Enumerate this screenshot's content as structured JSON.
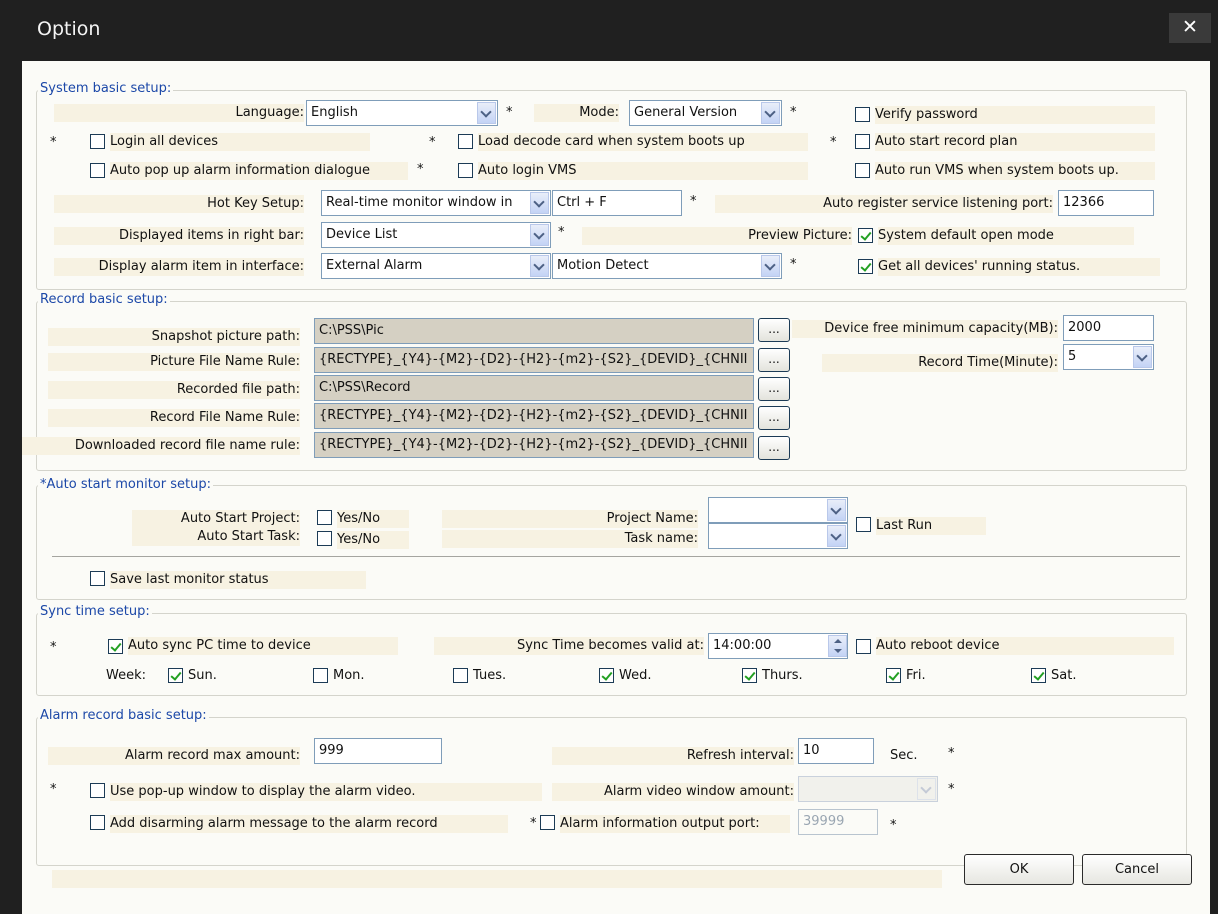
{
  "window": {
    "title": "Option",
    "close_glyph": "✕"
  },
  "star": "*",
  "system": {
    "title": "System basic setup:",
    "language_label": "Language:",
    "language_value": "English",
    "mode_label": "Mode:",
    "mode_value": "General Version",
    "verify_password": "Verify password",
    "login_all_devices": "Login all devices",
    "load_decode_card": "Load decode card when system boots up",
    "auto_start_record_plan": "Auto start record plan",
    "auto_popup_alarm": "Auto pop up alarm information dialogue",
    "auto_login_vms": "Auto login VMS",
    "auto_run_vms": "Auto run VMS when system boots up.",
    "hotkey_label": "Hot Key Setup:",
    "hotkey_select": "Real-time monitor window in",
    "hotkey_value": "Ctrl + F",
    "auto_register_label": "Auto register service listening port:",
    "auto_register_value": "12366",
    "right_bar_label": "Displayed items in right bar:",
    "right_bar_value": "Device List",
    "preview_label": "Preview Picture:",
    "preview_value": "System default open mode",
    "display_alarm_label": "Display alarm item in interface:",
    "display_alarm_value1": "External Alarm",
    "display_alarm_value2": "Motion Detect",
    "get_all_status": "Get all devices' running status."
  },
  "record": {
    "title": "Record basic setup:",
    "snapshot_label": "Snapshot picture path:",
    "snapshot_value": "C:\\PSS\\Pic",
    "picture_rule_label": "Picture File Name Rule:",
    "picture_rule_value": "{RECTYPE}_{Y4}-{M2}-{D2}-{H2}-{m2}-{S2}_{DEVID}_{CHNII",
    "recorded_path_label": "Recorded file  path:",
    "recorded_path_value": "C:\\PSS\\Record",
    "record_rule_label": "Record File Name Rule:",
    "record_rule_value": "{RECTYPE}_{Y4}-{M2}-{D2}-{H2}-{m2}-{S2}_{DEVID}_{CHNII",
    "downloaded_rule_label": "Downloaded record file name rule:",
    "downloaded_rule_value": "{RECTYPE}_{Y4}-{M2}-{D2}-{H2}-{m2}-{S2}_{DEVID}_{CHNII",
    "browse": "...",
    "free_cap_label": "Device free minimum capacity(MB):",
    "free_cap_value": "2000",
    "record_time_label": "Record Time(Minute):",
    "record_time_value": "5"
  },
  "monitor": {
    "title": "*Auto start monitor setup:",
    "auto_start_project_label": "Auto Start Project:",
    "auto_start_task_label": "Auto Start Task:",
    "yes_no": "Yes/No",
    "project_name_label": "Project Name:",
    "task_name_label": "Task name:",
    "last_run": "Last Run",
    "save_last_status": "Save last monitor status"
  },
  "sync": {
    "title": "Sync time setup:",
    "auto_sync": "Auto sync PC time to device",
    "valid_at_label": "Sync Time becomes valid at:",
    "valid_at_value": "14:00:00",
    "auto_reboot": "Auto reboot device",
    "week_label": "Week:",
    "days": [
      {
        "label": "Sun.",
        "checked": true
      },
      {
        "label": "Mon.",
        "checked": false
      },
      {
        "label": "Tues.",
        "checked": false
      },
      {
        "label": "Wed.",
        "checked": true
      },
      {
        "label": "Thurs.",
        "checked": true
      },
      {
        "label": "Fri.",
        "checked": true
      },
      {
        "label": "Sat.",
        "checked": true
      }
    ]
  },
  "alarm": {
    "title": "Alarm record basic setup:",
    "max_amount_label": "Alarm record max amount:",
    "max_amount_value": "999",
    "refresh_label": "Refresh interval:",
    "refresh_value": "10",
    "sec": "Sec.",
    "use_popup": "Use pop-up window to display the alarm video.",
    "video_window_label": "Alarm video window amount:",
    "add_disarming": "Add disarming alarm message to the alarm record",
    "output_port_label": "Alarm information output port:",
    "output_port_value": "39999"
  },
  "buttons": {
    "ok": "OK",
    "cancel": "Cancel"
  }
}
